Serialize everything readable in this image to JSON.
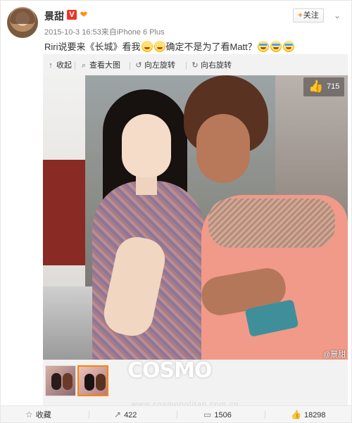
{
  "post": {
    "author": "景甜",
    "timestamp": "2015-10-3 16:53",
    "source_prefix": "来自",
    "source": "iPhone 6 Plus",
    "text_part1": "Riri说要来《长城》看我",
    "text_part2": "确定不是为了看Matt？",
    "follow_label": "关注",
    "follow_plus": "+"
  },
  "media_toolbar": {
    "collapse": "收起",
    "view_large": "查看大图",
    "rotate_left": "向左旋转",
    "rotate_right": "向右旋转"
  },
  "photo": {
    "like_count": "715",
    "watermark_at": "@",
    "watermark": "景甜"
  },
  "cosmo_watermark": {
    "logo": "COSMO",
    "url": "www.cosmopolitan.com.cn"
  },
  "actions": {
    "favorite": "收藏",
    "reposts": "422",
    "comments": "1506",
    "likes": "18298"
  },
  "icons": [
    "v-verified-icon",
    "heart-badge-icon",
    "chevron-down-icon",
    "collapse-icon",
    "zoom-icon",
    "rotate-left-icon",
    "rotate-right-icon",
    "thumbs-up-icon",
    "star-icon",
    "repost-icon",
    "comment-icon",
    "like-icon"
  ],
  "colors": {
    "accent": "#ff8200",
    "verified": "#e8372a"
  }
}
